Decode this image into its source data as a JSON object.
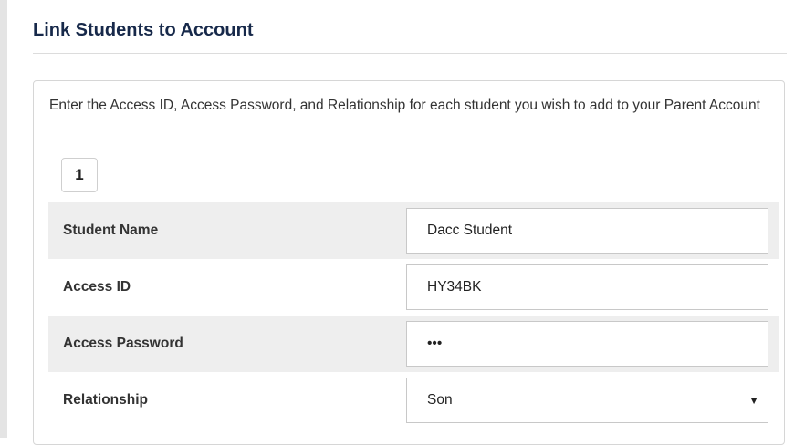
{
  "header": {
    "title": "Link Students to Account"
  },
  "panel": {
    "instructions": "Enter the Access ID, Access Password, and Relationship for each student you wish to add to your Parent Account",
    "student_number": "1",
    "rows": [
      {
        "label": "Student Name",
        "value": "Dacc Student"
      },
      {
        "label": "Access ID",
        "value": "HY34BK"
      },
      {
        "label": "Access Password",
        "value": "•••"
      },
      {
        "label": "Relationship",
        "value": "Son",
        "options_caret": "▼"
      }
    ]
  },
  "icons": {
    "select_caret": "chevron-down-icon"
  },
  "colors": {
    "title": "#17294a",
    "row_shade": "#eeeeee",
    "border": "#c8c8c8"
  }
}
